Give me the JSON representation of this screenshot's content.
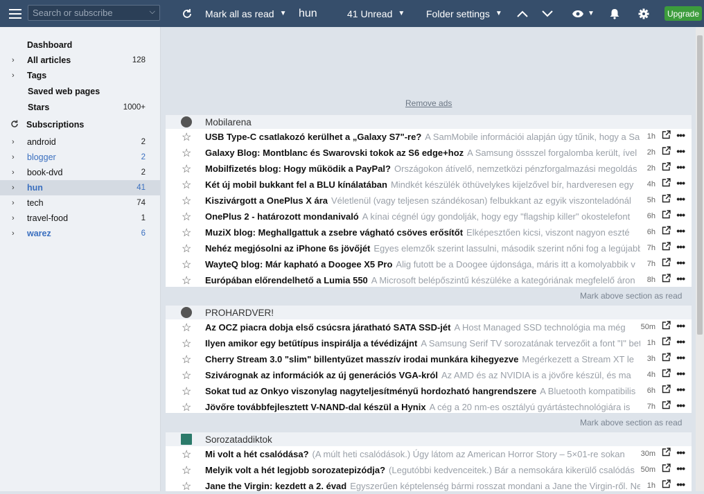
{
  "topbar": {
    "search_placeholder": "Search or subscribe",
    "mark_all_read": "Mark all as read",
    "feed_title": "hun",
    "unread": "41 Unread",
    "folder_settings": "Folder settings",
    "upgrade": "Upgrade"
  },
  "sidebar": {
    "dashboard": "Dashboard",
    "all_articles": {
      "label": "All articles",
      "count": "128"
    },
    "tags": "Tags",
    "saved_web_pages": "Saved web pages",
    "stars": {
      "label": "Stars",
      "count": "1000+"
    },
    "subscriptions": "Subscriptions",
    "folders": [
      {
        "label": "android",
        "count": "2"
      },
      {
        "label": "blogger",
        "count": "2"
      },
      {
        "label": "book-dvd",
        "count": "2"
      },
      {
        "label": "hun",
        "count": "41"
      },
      {
        "label": "tech",
        "count": "74"
      },
      {
        "label": "travel-food",
        "count": "1"
      },
      {
        "label": "warez",
        "count": "6"
      }
    ]
  },
  "main": {
    "remove_ads": "Remove ads",
    "mark_above": "Mark above section as read",
    "sections": [
      {
        "name": "Mobilarena",
        "items": [
          {
            "title": "USB Type-C csatlakozó kerülhet a „Galaxy S7\"-re?",
            "summary": "A SamMobile információi alapján úgy tűnik, hogy a Samsung",
            "time": "1h"
          },
          {
            "title": "Galaxy Blog: Montblanc és Swarovski tokok az S6 edge+hoz",
            "summary": "A Samsung össszel forgalomba került, ível",
            "time": "2h"
          },
          {
            "title": "Mobilfizetés blog: Hogy működik a PayPal?",
            "summary": "Országokon átívelő, nemzetközi pénzforgalmazási megoldás",
            "time": "2h"
          },
          {
            "title": "Két új mobil bukkant fel a BLU kínálatában",
            "summary": "Mindkét készülék öthüvelykes kijelzővel bír, hardveresen egy",
            "time": "4h"
          },
          {
            "title": "Kiszivárgott a OnePlus X ára",
            "summary": "Véletlenül (vagy teljesen szándékosan) felbukkant az egyik viszonteladónál",
            "time": "5h"
          },
          {
            "title": "OnePlus 2 - határozott mondanivaló",
            "summary": "A kínai cégnél úgy gondolják, hogy egy \"flagship killer\" okostelefont",
            "time": "6h"
          },
          {
            "title": "MuziX blog: Meghallgattuk a zsebre vágható csöves erősítőt",
            "summary": "Elképesztően kicsi, viszont nagyon eszté",
            "time": "6h"
          },
          {
            "title": "Nehéz megjósolni az iPhone 6s jövőjét",
            "summary": "Egyes elemzők szerint lassulni, második szerint nőni fog a legújabb",
            "time": "7h"
          },
          {
            "title": "WayteQ blog: Már kapható a Doogee X5 Pro",
            "summary": "Alig futott be a Doogee újdonsága, máris itt a komolyabbik v",
            "time": "7h"
          },
          {
            "title": "Európában előrendelhető a Lumia 550",
            "summary": "A Microsoft belépőszintű készüléke a kategóriának megfelelő áron",
            "time": "8h"
          }
        ]
      },
      {
        "name": "PROHARDVER!",
        "items": [
          {
            "title": "Az OCZ piacra dobja első csúcsra járatható SATA SSD-jét",
            "summary": "A Host Managed SSD technológia ma még",
            "time": "50m"
          },
          {
            "title": "Ilyen amikor egy betűtípus inspirálja a tévédizájnt",
            "summary": "A Samsung Serif TV sorozatának tervezőit a font \"I\" betű",
            "time": "1h"
          },
          {
            "title": "Cherry Stream 3.0 \"slim\" billentyűzet masszív irodai munkára kihegyezve",
            "summary": "Megérkezett a Stream XT le",
            "time": "3h"
          },
          {
            "title": "Szivárognak az információk az új generációs VGA-król",
            "summary": "Az AMD és az NVIDIA is a jövőre készül, és ma",
            "time": "4h"
          },
          {
            "title": "Sokat tud az Onkyo viszonylag nagyteljesítményű hordozható hangrendszere",
            "summary": "A Bluetooth kompatibilis",
            "time": "6h"
          },
          {
            "title": "Jövőre továbbfejlesztett V-NAND-dal készül a Hynix",
            "summary": "A cég a 20 nm-es osztályú gyártástechnológiára is",
            "time": "7h"
          }
        ]
      },
      {
        "name": "Sorozataddiktok",
        "items": [
          {
            "title": "Mi volt a hét csalódása?",
            "summary": "(A múlt heti csalódások.) Úgy látom az American Horror Story – 5×01-re sokan",
            "time": "30m"
          },
          {
            "title": "Melyik volt a hét legjobb sorozatepizódja?",
            "summary": "(Legutóbbi kedvenceitek.) Bár a nemsokára kikerülő csalódás",
            "time": "50m"
          },
          {
            "title": "Jane the Virgin: kezdett a 2. évad",
            "summary": "Egyszerűen képtelenség bármi rosszat mondani a Jane the Virgin-ről. Nem",
            "time": "1h"
          }
        ]
      }
    ]
  }
}
